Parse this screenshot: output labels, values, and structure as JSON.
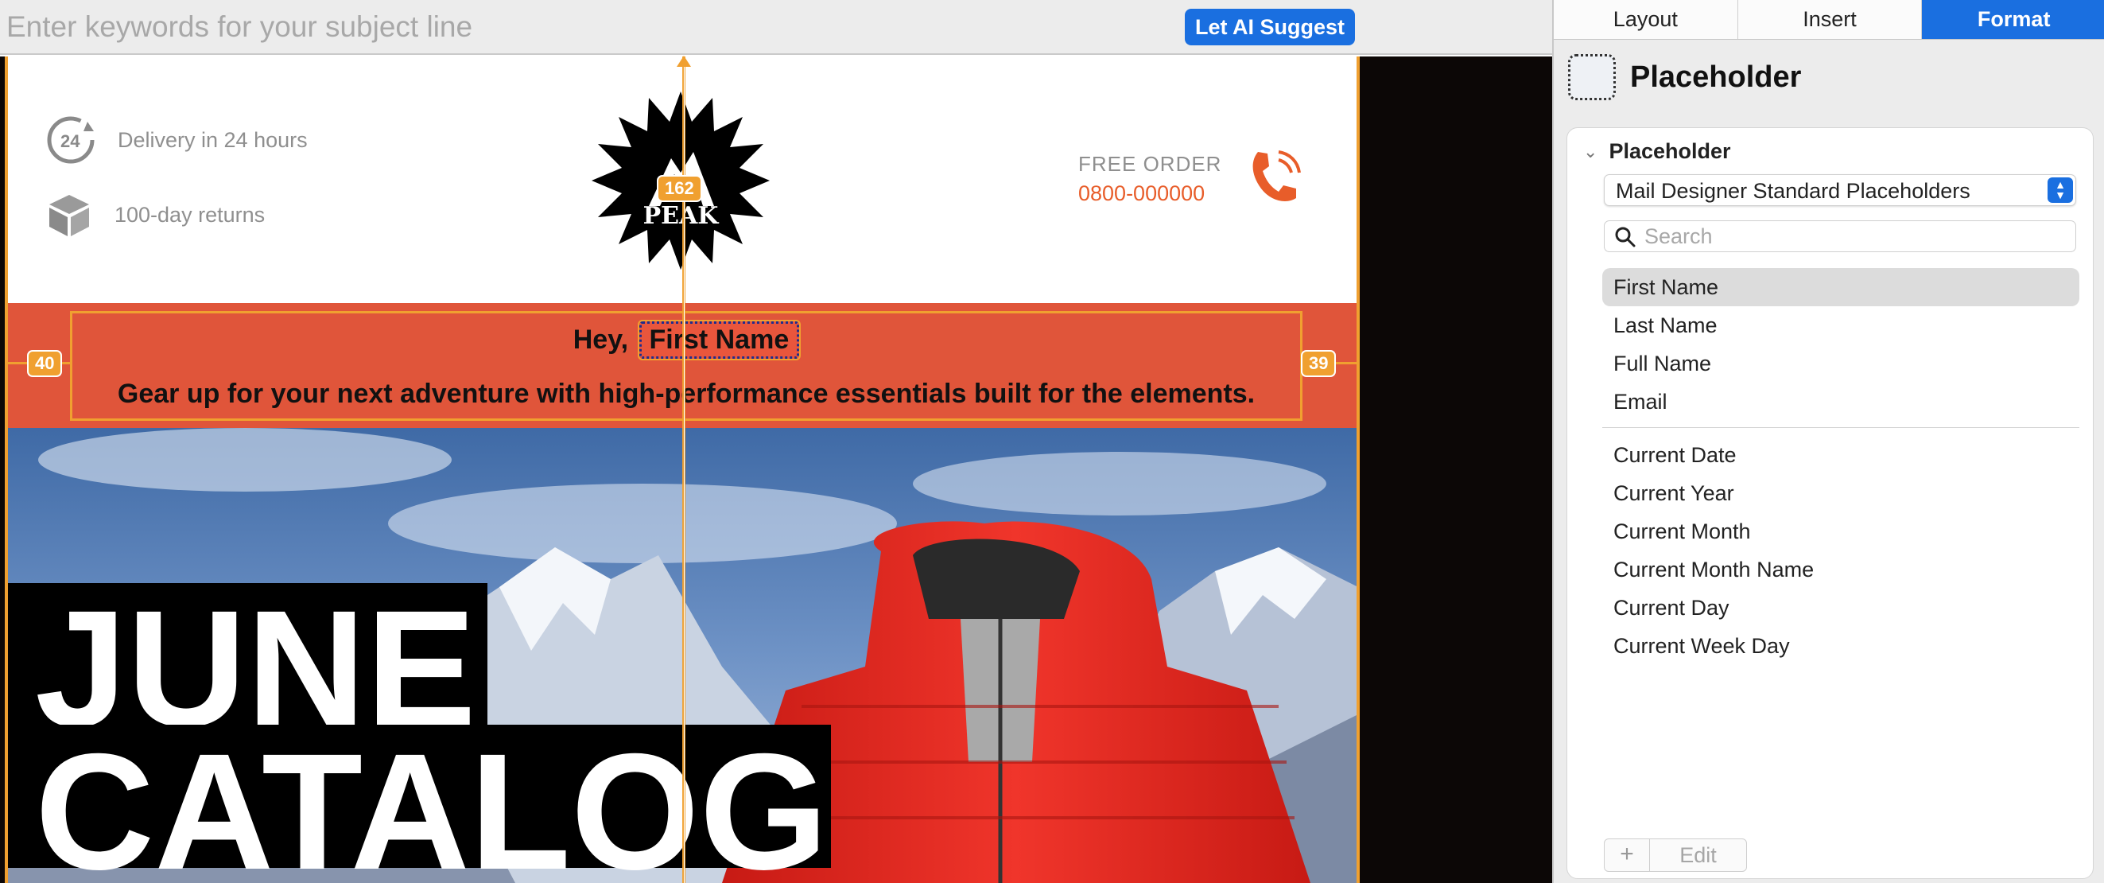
{
  "subject": {
    "placeholder": "Enter keywords for your subject line",
    "ai_button": "Let AI Suggest"
  },
  "email": {
    "header": {
      "feature1": "Delivery in 24 hours",
      "feature2": "100-day returns",
      "icon1_text": "24",
      "logo_text": "PEAK",
      "free_order_label": "FREE ORDER",
      "free_order_phone": "0800-000000"
    },
    "banner": {
      "greeting": "Hey,",
      "placeholder_token": "First Name",
      "subline": "Gear up for your next adventure with high-performance essentials built for the elements."
    },
    "hero": {
      "title_line1": "JUNE",
      "title_line2": "CATALOG"
    }
  },
  "guides": {
    "top_badge": "162",
    "left_badge": "40",
    "right_badge": "39"
  },
  "panel": {
    "tabs": [
      "Layout",
      "Insert",
      "Format"
    ],
    "active_tab": "Format",
    "title": "Placeholder",
    "section_title": "Placeholder",
    "source_select": "Mail Designer Standard Placeholders",
    "search_placeholder": "Search",
    "group1": [
      "First Name",
      "Last Name",
      "Full Name",
      "Email"
    ],
    "group2": [
      "Current Date",
      "Current Year",
      "Current Month",
      "Current Month Name",
      "Current Day",
      "Current Week Day"
    ],
    "selected_item": "First Name",
    "add_button": "+",
    "edit_button": "Edit"
  },
  "colors": {
    "accent_blue": "#1a6fe0",
    "banner_orange": "#e0553a",
    "guide_orange": "#f0a030",
    "phone_orange": "#e85d2a"
  }
}
